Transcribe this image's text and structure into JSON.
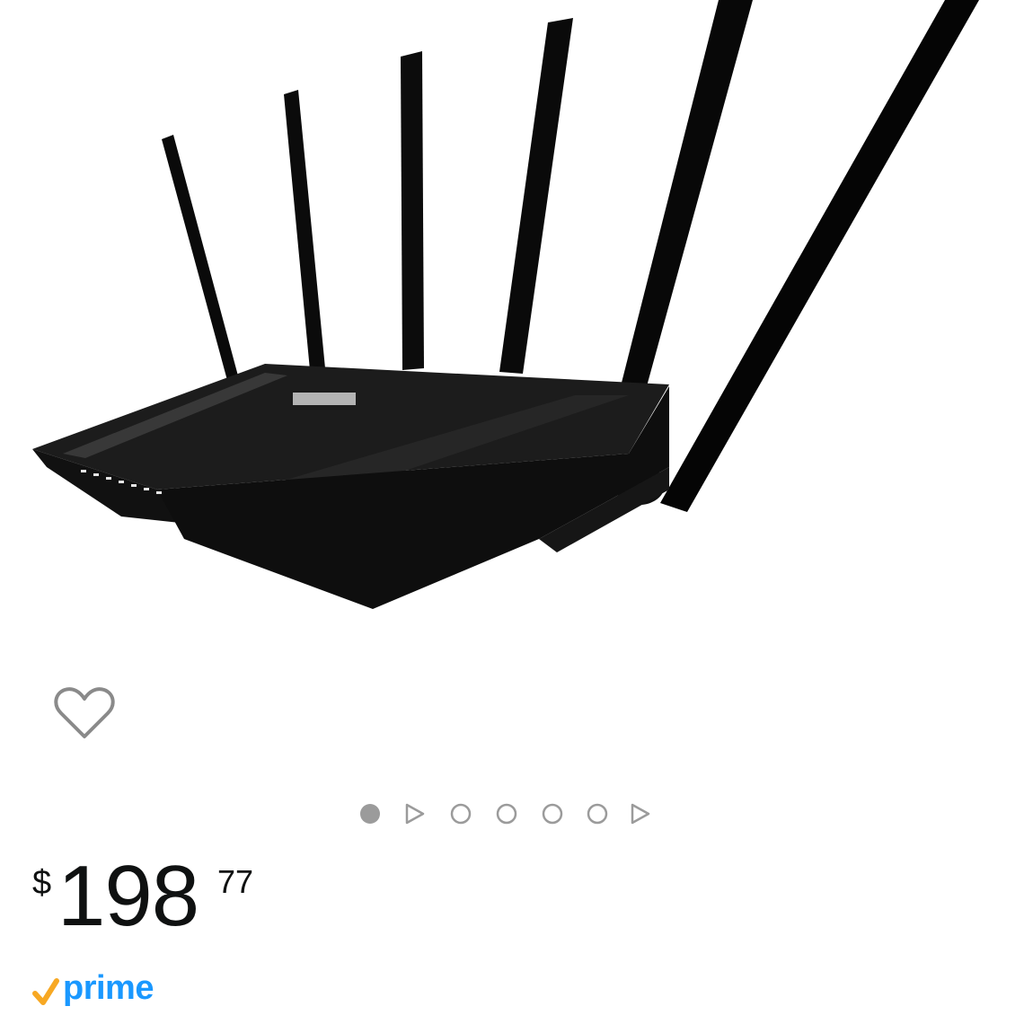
{
  "product": {
    "image_subject": "router-with-six-antennas"
  },
  "wishlist": {
    "icon": "heart-outline-icon"
  },
  "carousel": {
    "active_index": 0,
    "items": [
      "image",
      "video",
      "image",
      "image",
      "image",
      "image",
      "video"
    ]
  },
  "price": {
    "symbol": "$",
    "whole": "198",
    "fraction": "77"
  },
  "badge": {
    "label": "prime",
    "brand_color": "#1a98ff",
    "check_color": "#f7a823"
  },
  "colors": {
    "dot_active": "#9b9b9b",
    "dot_inactive": "#9b9b9b",
    "heart_stroke": "#8a8a8a"
  }
}
